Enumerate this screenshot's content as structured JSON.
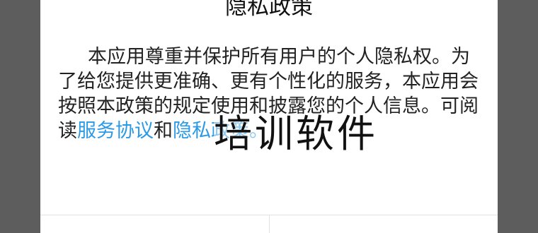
{
  "dialog": {
    "title": "隐私政策",
    "body_prefix": "本应用尊重并保护所有用户的个人隐私权。为了给您提供更准确、更有个性化的服务，本应用会按照本政策的规定使用和披露您的个人信息。可阅读",
    "link_service": "服务协议",
    "connector": "和",
    "link_privacy": "隐私政策",
    "suffix": "。"
  },
  "watermark": {
    "text": "培训软件"
  },
  "buttons": {
    "left_label": "",
    "right_label": ""
  },
  "colors": {
    "backdrop": "#5d5d5d",
    "dialog_bg": "#ffffff",
    "text": "#222222",
    "link": "#2a9ae8",
    "divider": "#e1e1e1"
  }
}
